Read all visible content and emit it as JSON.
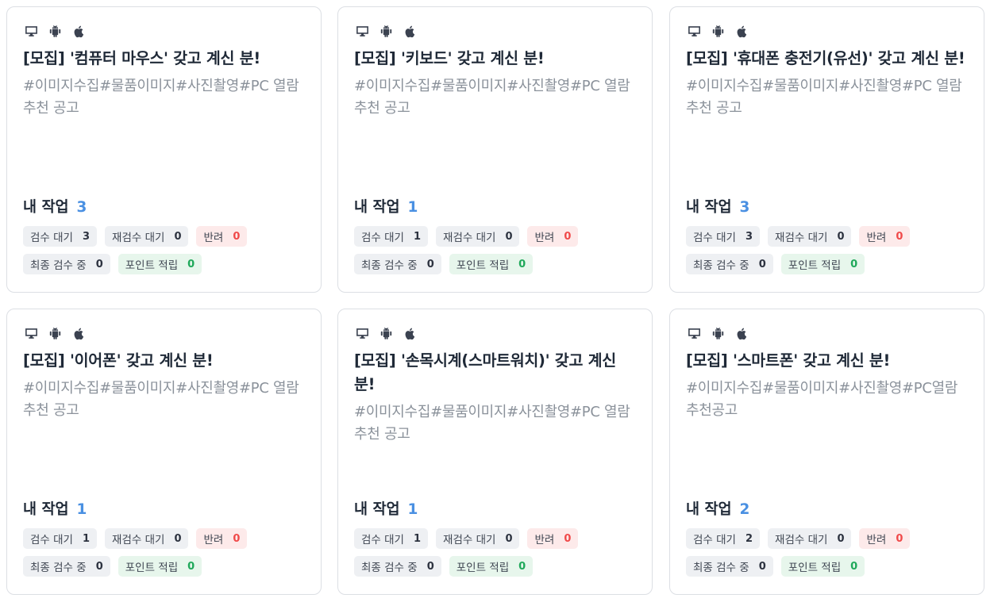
{
  "labels": {
    "my_work": "내 작업",
    "pending_review": "검수 대기",
    "re_review": "재검수 대기",
    "rejected": "반려",
    "final_review": "최종 검수 중",
    "points_earned": "포인트 적립"
  },
  "colors": {
    "count_blue": "#4a90e2",
    "rejected_red": "#f04a4a",
    "points_green": "#1fa85a"
  },
  "platform_icons": [
    "desktop-icon",
    "android-icon",
    "apple-icon"
  ],
  "cards": [
    {
      "title": "[모집] '컴퓨터 마우스' 갖고 계신 분!",
      "tags": "#이미지수집#물품이미지#사진촬영#PC 열람 추천 공고",
      "my_work_count": "3",
      "pending": "3",
      "re_review": "0",
      "rejected": "0",
      "final": "0",
      "points": "0"
    },
    {
      "title": "[모집] '키보드' 갖고 계신 분!",
      "tags": "#이미지수집#물품이미지#사진촬영#PC 열람 추천 공고",
      "my_work_count": "1",
      "pending": "1",
      "re_review": "0",
      "rejected": "0",
      "final": "0",
      "points": "0"
    },
    {
      "title": "[모집] '휴대폰 충전기(유선)' 갖고 계신 분!",
      "tags": "#이미지수집#물품이미지#사진촬영#PC 열람 추천 공고",
      "my_work_count": "3",
      "pending": "3",
      "re_review": "0",
      "rejected": "0",
      "final": "0",
      "points": "0"
    },
    {
      "title": "[모집] '이어폰' 갖고 계신 분!",
      "tags": "#이미지수집#물품이미지#사진촬영#PC 열람 추천 공고",
      "my_work_count": "1",
      "pending": "1",
      "re_review": "0",
      "rejected": "0",
      "final": "0",
      "points": "0"
    },
    {
      "title": "[모집] '손목시계(스마트워치)' 갖고 계신 분!",
      "tags": "#이미지수집#물품이미지#사진촬영#PC 열람 추천 공고",
      "my_work_count": "1",
      "pending": "1",
      "re_review": "0",
      "rejected": "0",
      "final": "0",
      "points": "0"
    },
    {
      "title": "[모집] '스마트폰' 갖고 계신 분!",
      "tags": "#이미지수집#물품이미지#사진촬영#PC열람 추천공고",
      "my_work_count": "2",
      "pending": "2",
      "re_review": "0",
      "rejected": "0",
      "final": "0",
      "points": "0"
    }
  ]
}
